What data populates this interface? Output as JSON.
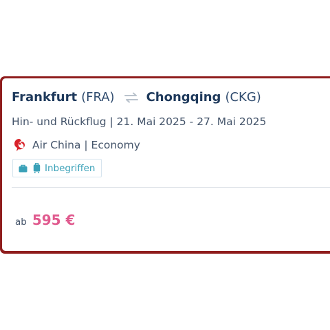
{
  "offer": {
    "origin_city": "Frankfurt",
    "origin_code": "(FRA)",
    "destination_city": "Chongqing",
    "destination_code": "(CKG)",
    "trip_dates": "Hin- und Rückflug | 21. Mai 2025 - 27. Mai 2025",
    "airline_class": "Air China | Economy",
    "baggage_label": "Inbegriffen",
    "price_prefix": "ab",
    "price": "595 €"
  },
  "colors": {
    "frame": "#8f1d1d",
    "title": "#1f3a5c",
    "text": "#44546a",
    "baggage": "#3aa1b8",
    "price": "#e05a8e",
    "airline_logo": "#d8232a"
  },
  "icons": {
    "swap": "swap-arrows-icon",
    "airline": "air-china-logo-icon",
    "personal_bag": "handbag-icon",
    "cabin_bag": "trolley-icon"
  }
}
